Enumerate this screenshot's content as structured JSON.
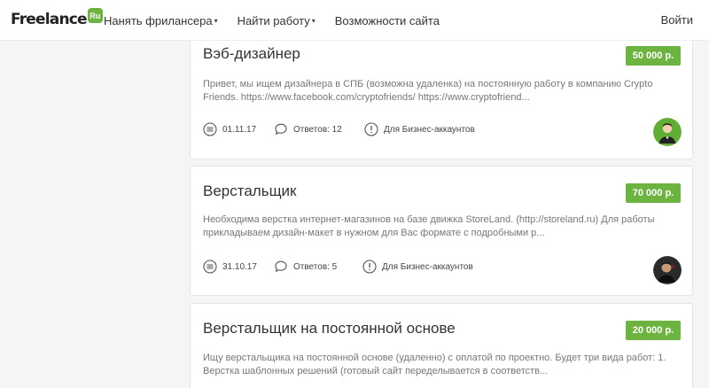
{
  "header": {
    "logo_text": "Freelance",
    "logo_badge": "Ru",
    "nav": [
      {
        "label": "Нанять фрилансера",
        "caret": "▾"
      },
      {
        "label": "Найти работу",
        "caret": "▾"
      },
      {
        "label": "Возможности сайта",
        "caret": ""
      }
    ],
    "login": "Войти"
  },
  "projects": [
    {
      "title": "Вэб-дизайнер",
      "price": "50 000 р.",
      "description": "Привет, мы ищем дизайнера в СПБ (возможна удаленка) на постоянную работу в компанию Crypto Friends. https://www.facebook.com/cryptofriends/ https://www.cryptofriend...",
      "date": "01.11.17",
      "responses": "Ответов: 12",
      "access": "Для Бизнес-аккаунтов"
    },
    {
      "title": "Верстальщик",
      "price": "70 000 р.",
      "description": "Необходима верстка интернет-магазинов на базе движка StoreLand. (http://storeland.ru) Для работы прикладываем дизайн-макет в нужном для Вас формате с подробными р...",
      "date": "31.10.17",
      "responses": "Ответов: 5",
      "access": "Для Бизнес-аккаунтов"
    },
    {
      "title": "Верстальщик на постоянной основе",
      "price": "20 000 р.",
      "description": "Ищу верстальщика на постоянной основе (удаленно) с оплатой по проектно. Будет три вида работ: 1. Верстка шаблонных решений (готовый сайт переделывается в соответств..."
    }
  ],
  "colors": {
    "accent": "#6db33f",
    "background": "#f5f5f5",
    "card": "#ffffff"
  },
  "icons": {
    "date": "calendar-list-icon",
    "responses": "speech-bubble-icon",
    "access": "exclamation-circle-icon"
  }
}
